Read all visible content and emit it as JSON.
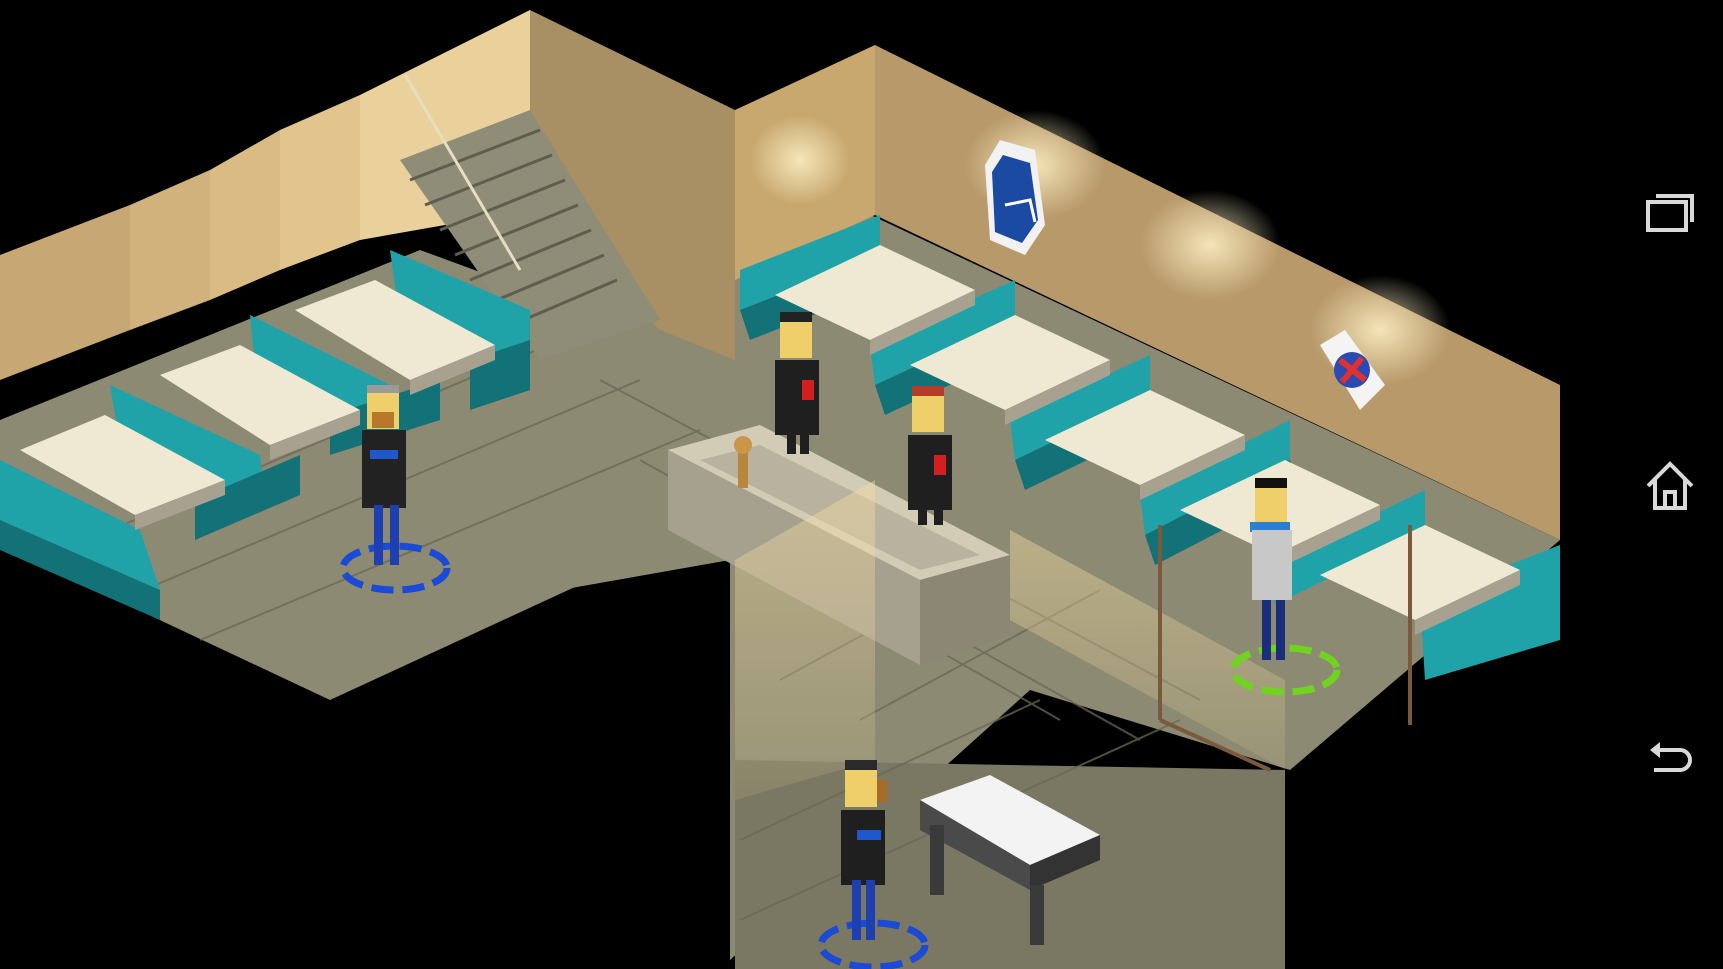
{
  "scene": {
    "type": "isometric-diner-interior",
    "colors": {
      "floor": "#8c8a72",
      "floor_dark": "#6d6b58",
      "wall": "#b99e6f",
      "wall_light": "#e3c48c",
      "booth": "#1fa3a8",
      "booth_dark": "#137277",
      "table_top": "#efe9d4",
      "table_side": "#a8a190",
      "selection_blue": "#1a4ad6",
      "selection_green": "#6fd320",
      "background": "#000000"
    },
    "characters": [
      {
        "name": "bearded-man-blue-shirt",
        "selection": "blue"
      },
      {
        "name": "man-red-shirt-at-booth",
        "selection": "none"
      },
      {
        "name": "man-red-shirt-by-counter",
        "selection": "none"
      },
      {
        "name": "man-grey-shirt-right",
        "selection": "green"
      },
      {
        "name": "woman-ponytail-bottom",
        "selection": "blue"
      }
    ],
    "posters": [
      {
        "name": "cccp-poster-icon"
      },
      {
        "name": "round-emblem-poster-icon"
      }
    ],
    "objects": [
      {
        "name": "trophy-on-counter-icon"
      }
    ]
  },
  "navbar": {
    "icons": [
      "recent-apps-icon",
      "home-icon",
      "back-icon"
    ]
  }
}
